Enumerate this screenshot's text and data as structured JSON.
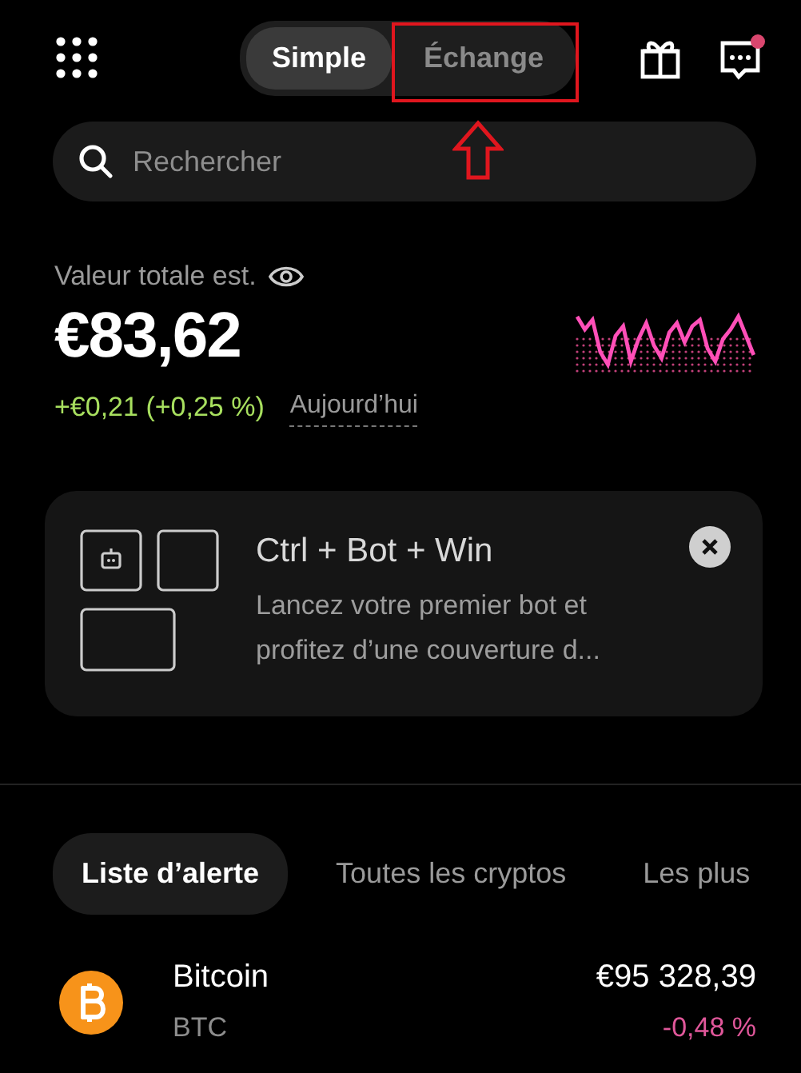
{
  "header": {
    "modes": [
      {
        "label": "Simple",
        "selected": true,
        "highlighted": false
      },
      {
        "label": "Échange",
        "selected": false,
        "highlighted": true
      }
    ],
    "notification_unread": true
  },
  "search": {
    "placeholder": "Rechercher"
  },
  "portfolio": {
    "label": "Valeur totale est.",
    "value": "€83,62",
    "change": "+€0,21 (+0,25 %)",
    "period": "Aujourd’hui"
  },
  "promo": {
    "title": "Ctrl + Bot + Win",
    "text": "Lancez votre premier bot et profitez d’une couverture d..."
  },
  "tabs": [
    {
      "label": "Liste d’alerte",
      "selected": true
    },
    {
      "label": "Toutes les cryptos",
      "selected": false
    },
    {
      "label": "Les plus",
      "selected": false
    }
  ],
  "assets": [
    {
      "name": "Bitcoin",
      "symbol": "BTC",
      "price": "€95 328,39",
      "change": {
        "text": "-0,48 %",
        "color": "#e0579a"
      },
      "color": "#f7931a"
    }
  ]
}
